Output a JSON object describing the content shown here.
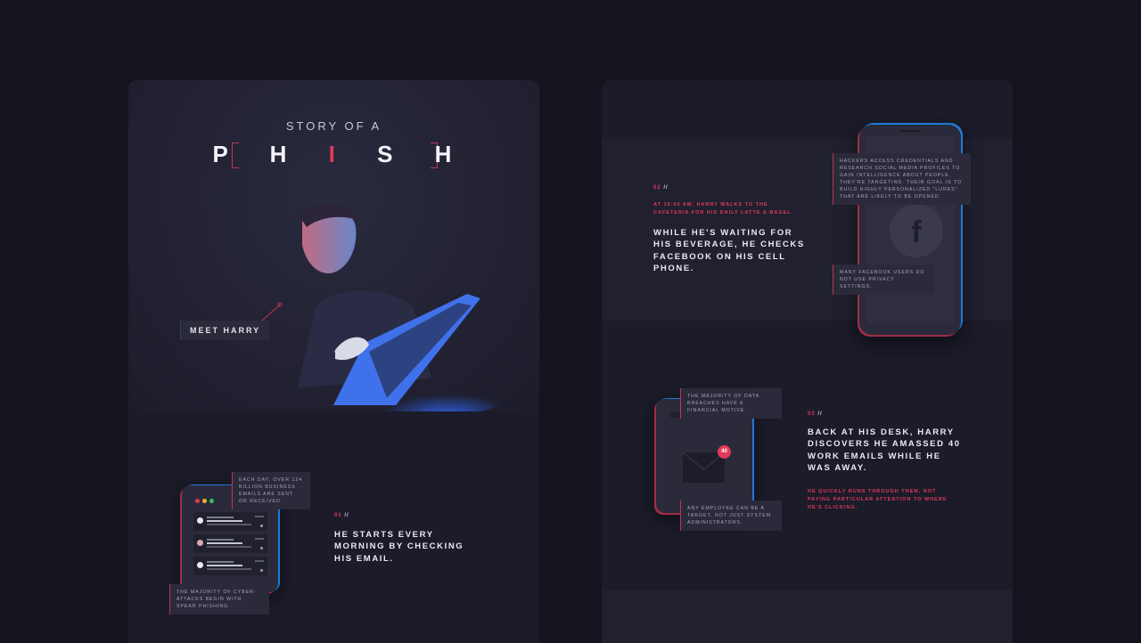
{
  "left_panel": {
    "story_sub": "STORY OF A",
    "title_before": "P H ",
    "title_highlight": "I",
    "title_after": " S H",
    "meet_label": "MEET HARRY",
    "email_phone": {
      "tooltip_top": "EACH DAY, OVER 124 BILLION BUSINESS EMAILS ARE SENT OR RECEIVED.",
      "tooltip_bottom": "THE MAJORITY OF CYBER-ATTACKS BEGIN WITH SPEAR PHISHING."
    },
    "step1": {
      "number": "01",
      "slashes": "//",
      "heading": "HE STARTS EVERY MORNING BY CHECKING HIS EMAIL."
    }
  },
  "right_panel": {
    "step2": {
      "number": "02",
      "slashes": "//",
      "pink_text": "AT 10:00 AM, HARRY WALKS TO THE CAFETERIA FOR HIS DAILY LATTE & BAGEL.",
      "heading": "WHILE HE'S WAITING FOR HIS BEVERAGE, HE CHECKS FACEBOOK ON HIS CELL PHONE."
    },
    "fb_phone": {
      "icon_letter": "f",
      "tooltip_top": "HACKERS ACCESS CREDENTIALS AND RESEARCH SOCIAL MEDIA PROFILES TO GAIN INTELLIGENCE ABOUT PEOPLE THEY'RE TARGETING. THEIR GOAL IS TO BUILD HIGHLY PERSONALIZED \"LURES\" THAT ARE LIKELY TO BE OPENED.",
      "tooltip_bottom": "MANY FACEBOOK USERS DO NOT USE PRIVACY SETTINGS."
    },
    "step3": {
      "number": "03",
      "slashes": "//",
      "heading": "BACK AT HIS DESK, HARRY DISCOVERS HE AMASSED 40 WORK EMAILS WHILE HE WAS AWAY.",
      "pink_text": "HE QUICKLY RUNS THROUGH THEM, NOT PAYING PARTICULAR ATTENTION TO WHERE HE'S CLICKING."
    },
    "mail_phone": {
      "badge_count": "40",
      "tooltip_top": "THE MAJORITY OF DATA BREACHES HAVE A FINANCIAL MOTIVE.",
      "tooltip_bottom": "ANY EMPLOYEE CAN BE A TARGET, NOT JUST SYSTEM ADMINISTRATORS."
    }
  },
  "colors": {
    "accent_red": "#e23a5b",
    "accent_blue": "#1e7ad6",
    "background": "#14141f"
  }
}
